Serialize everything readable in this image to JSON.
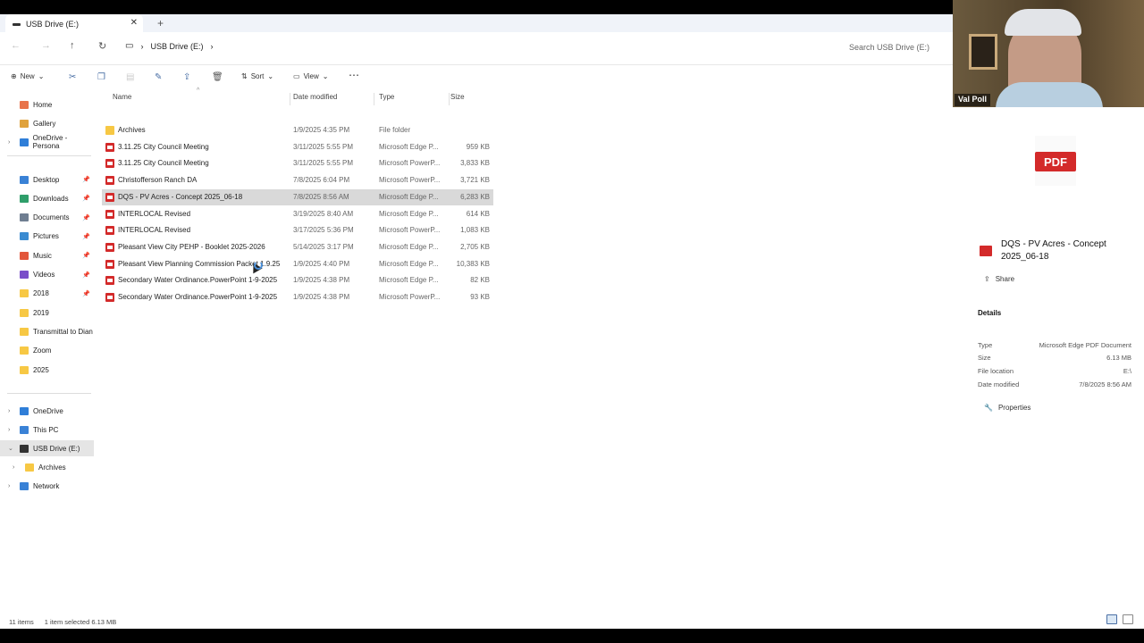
{
  "window": {
    "tab_title": "USB Drive (E:)",
    "tab_close": "✕",
    "new_tab": "+"
  },
  "address": {
    "breadcrumb": [
      "USB Drive (E:)"
    ],
    "search_placeholder": "Search USB Drive (E:)"
  },
  "commands": {
    "new": "New",
    "sort": "Sort",
    "view": "View",
    "more": "⋯"
  },
  "sidebar": {
    "quick": [
      {
        "label": "Home",
        "color": "#e8734a"
      },
      {
        "label": "Gallery",
        "color": "#e0a23c"
      },
      {
        "label": "OneDrive - Persona",
        "color": "#2f7ed8"
      }
    ],
    "pinned": [
      {
        "label": "Desktop",
        "color": "#3a82d6"
      },
      {
        "label": "Downloads",
        "color": "#2f9e6a"
      },
      {
        "label": "Documents",
        "color": "#6f7e91"
      },
      {
        "label": "Pictures",
        "color": "#3b8bd1"
      },
      {
        "label": "Music",
        "color": "#e2563b"
      },
      {
        "label": "Videos",
        "color": "#7a4ec9"
      },
      {
        "label": "2018",
        "color": "#f7c844"
      },
      {
        "label": "2019",
        "color": "#f7c844"
      },
      {
        "label": "Transmittal to Dian",
        "color": "#f7c844"
      },
      {
        "label": "Zoom",
        "color": "#f7c844"
      },
      {
        "label": "2025",
        "color": "#f7c844"
      }
    ],
    "devices": [
      {
        "label": "OneDrive",
        "color": "#2f7ed8"
      },
      {
        "label": "This PC",
        "color": "#3a82d6"
      },
      {
        "label": "USB Drive (E:)",
        "color": "#333333"
      },
      {
        "label": "Archives",
        "color": "#f7c844"
      },
      {
        "label": "Network",
        "color": "#3a82d6"
      }
    ]
  },
  "columns": {
    "name": "Name",
    "date": "Date modified",
    "type": "Type",
    "size": "Size"
  },
  "files": [
    {
      "name": "Archives",
      "date": "1/9/2025 4:35 PM",
      "type": "File folder",
      "size": "",
      "kind": "folder"
    },
    {
      "name": "3.11.25 City Council Meeting",
      "date": "3/11/2025 5:55 PM",
      "type": "Microsoft Edge P...",
      "size": "959 KB",
      "kind": "pdf"
    },
    {
      "name": "3.11.25 City Council Meeting",
      "date": "3/11/2025 5:55 PM",
      "type": "Microsoft PowerP...",
      "size": "3,833 KB",
      "kind": "pdf"
    },
    {
      "name": "Christofferson Ranch DA",
      "date": "7/8/2025 6:04 PM",
      "type": "Microsoft PowerP...",
      "size": "3,721 KB",
      "kind": "pdf"
    },
    {
      "name": "DQS - PV Acres - Concept 2025_06-18",
      "date": "7/8/2025 8:56 AM",
      "type": "Microsoft Edge P...",
      "size": "6,283 KB",
      "kind": "pdf"
    },
    {
      "name": "INTERLOCAL Revised",
      "date": "3/19/2025 8:40 AM",
      "type": "Microsoft Edge P...",
      "size": "614 KB",
      "kind": "pdf"
    },
    {
      "name": "INTERLOCAL Revised",
      "date": "3/17/2025 5:36 PM",
      "type": "Microsoft PowerP...",
      "size": "1,083 KB",
      "kind": "pdf"
    },
    {
      "name": "Pleasant View City PEHP - Booklet 2025-2026",
      "date": "5/14/2025 3:17 PM",
      "type": "Microsoft Edge P...",
      "size": "2,705 KB",
      "kind": "pdf"
    },
    {
      "name": "Pleasant View Planning Commission Packet 1.9.25",
      "date": "1/9/2025 4:40 PM",
      "type": "Microsoft Edge P...",
      "size": "10,383 KB",
      "kind": "pdf"
    },
    {
      "name": "Secondary Water Ordinance.PowerPoint 1-9-2025",
      "date": "1/9/2025 4:38 PM",
      "type": "Microsoft Edge P...",
      "size": "82 KB",
      "kind": "pdf"
    },
    {
      "name": "Secondary Water Ordinance.PowerPoint 1-9-2025",
      "date": "1/9/2025 4:38 PM",
      "type": "Microsoft PowerP...",
      "size": "93 KB",
      "kind": "pdf"
    }
  ],
  "preview": {
    "badge": "PDF",
    "title": "DQS - PV Acres - Concept 2025_06-18",
    "share": "Share",
    "details_heading": "Details",
    "details": [
      {
        "k": "Type",
        "v": "Microsoft Edge PDF Document"
      },
      {
        "k": "Size",
        "v": "6.13 MB"
      },
      {
        "k": "File location",
        "v": "E:\\"
      },
      {
        "k": "Date modified",
        "v": "7/8/2025 8:56 AM"
      }
    ],
    "properties": "Properties"
  },
  "video": {
    "name": "Val Poll"
  },
  "status": {
    "items": "11 items",
    "selected": "1 item selected  6.13 MB"
  }
}
